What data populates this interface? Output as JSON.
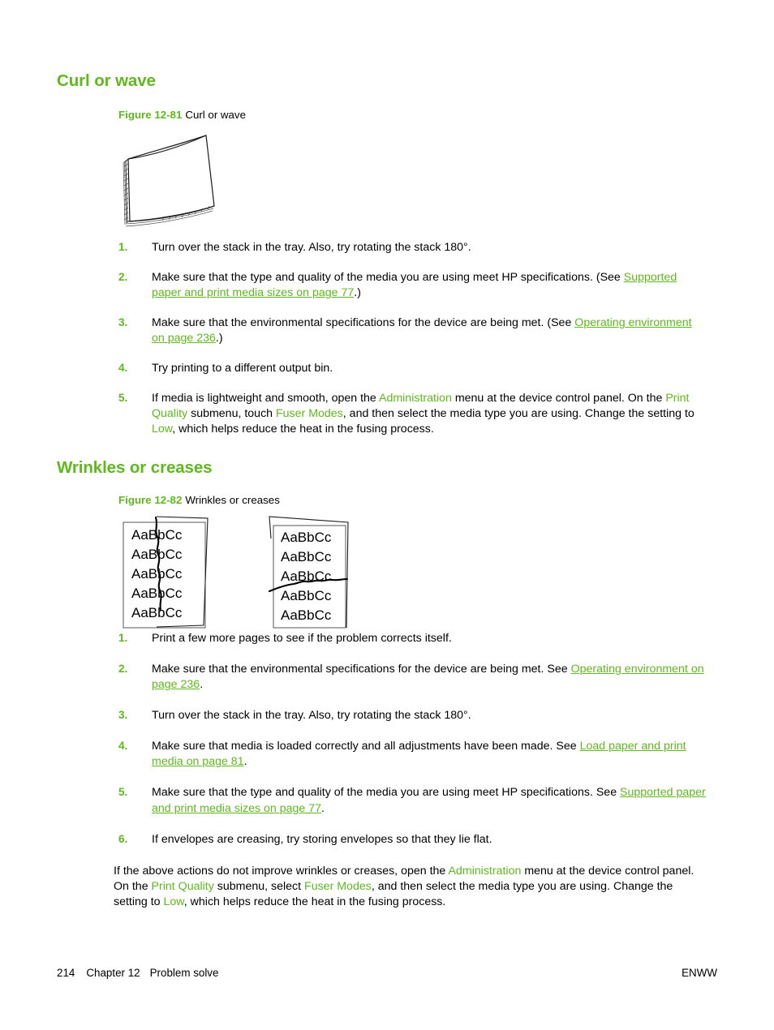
{
  "sections": [
    {
      "heading": "Curl or wave",
      "figure": {
        "number": "Figure 12-81",
        "title": "Curl or wave",
        "art": "curled-paper-stack"
      },
      "steps": [
        {
          "num": "1.",
          "parts": [
            {
              "type": "text",
              "value": "Turn over the stack in the tray. Also, try rotating the stack 180°."
            }
          ]
        },
        {
          "num": "2.",
          "parts": [
            {
              "type": "text",
              "value": "Make sure that the type and quality of the media you are using meet HP specifications. (See "
            },
            {
              "type": "link",
              "value": "Supported paper and print media sizes on page 77"
            },
            {
              "type": "text",
              "value": ".)"
            }
          ]
        },
        {
          "num": "3.",
          "parts": [
            {
              "type": "text",
              "value": "Make sure that the environmental specifications for the device are being met. (See "
            },
            {
              "type": "link",
              "value": "Operating environment on page 236"
            },
            {
              "type": "text",
              "value": ".)"
            }
          ]
        },
        {
          "num": "4.",
          "parts": [
            {
              "type": "text",
              "value": "Try printing to a different output bin."
            }
          ]
        },
        {
          "num": "5.",
          "parts": [
            {
              "type": "text",
              "value": "If media is lightweight and smooth, open the "
            },
            {
              "type": "ui",
              "value": "Administration"
            },
            {
              "type": "text",
              "value": " menu at the device control panel. On the "
            },
            {
              "type": "ui",
              "value": "Print Quality"
            },
            {
              "type": "text",
              "value": " submenu, touch "
            },
            {
              "type": "ui",
              "value": "Fuser Modes"
            },
            {
              "type": "text",
              "value": ", and then select the media type you are using. Change the setting to "
            },
            {
              "type": "ui",
              "value": "Low"
            },
            {
              "type": "text",
              "value": ", which helps reduce the heat in the fusing process."
            }
          ]
        }
      ]
    },
    {
      "heading": "Wrinkles or creases",
      "figure": {
        "number": "Figure 12-82",
        "title": "Wrinkles or creases",
        "art": "wrinkled-pages",
        "sample_text": "AaBbCc",
        "sample_lines": 5
      },
      "steps": [
        {
          "num": "1.",
          "parts": [
            {
              "type": "text",
              "value": "Print a few more pages to see if the problem corrects itself."
            }
          ]
        },
        {
          "num": "2.",
          "parts": [
            {
              "type": "text",
              "value": "Make sure that the environmental specifications for the device are being met. See "
            },
            {
              "type": "link",
              "value": "Operating environment on page 236"
            },
            {
              "type": "text",
              "value": "."
            }
          ]
        },
        {
          "num": "3.",
          "parts": [
            {
              "type": "text",
              "value": "Turn over the stack in the tray. Also, try rotating the stack 180°."
            }
          ]
        },
        {
          "num": "4.",
          "parts": [
            {
              "type": "text",
              "value": "Make sure that media is loaded correctly and all adjustments have been made. See "
            },
            {
              "type": "link",
              "value": "Load paper and print media on page 81"
            },
            {
              "type": "text",
              "value": "."
            }
          ]
        },
        {
          "num": "5.",
          "parts": [
            {
              "type": "text",
              "value": "Make sure that the type and quality of the media you are using meet HP specifications. See "
            },
            {
              "type": "link",
              "value": "Supported paper and print media sizes on page 77"
            },
            {
              "type": "text",
              "value": "."
            }
          ]
        },
        {
          "num": "6.",
          "parts": [
            {
              "type": "text",
              "value": "If envelopes are creasing, try storing envelopes so that they lie flat."
            }
          ]
        }
      ],
      "closing_paragraph": [
        {
          "type": "text",
          "value": "If the above actions do not improve wrinkles or creases, open the "
        },
        {
          "type": "ui",
          "value": "Administration"
        },
        {
          "type": "text",
          "value": " menu at the device control panel. On the "
        },
        {
          "type": "ui",
          "value": "Print Quality"
        },
        {
          "type": "text",
          "value": " submenu, select "
        },
        {
          "type": "ui",
          "value": "Fuser Modes"
        },
        {
          "type": "text",
          "value": ", and then select the media type you are using. Change the setting to "
        },
        {
          "type": "ui",
          "value": "Low"
        },
        {
          "type": "text",
          "value": ", which helps reduce the heat in the fusing process."
        }
      ]
    }
  ],
  "footer": {
    "page_number": "214",
    "chapter": "Chapter 12",
    "chapter_title": "Problem solve",
    "right_label": "ENWW"
  },
  "colors": {
    "heading_green": "#5FB81E",
    "link_green": "#5FB81E",
    "ui_term_green": "#5FB81E",
    "body_text": "#000000",
    "page_background": "#FFFFFF",
    "line_art": "#1A1A1A"
  }
}
